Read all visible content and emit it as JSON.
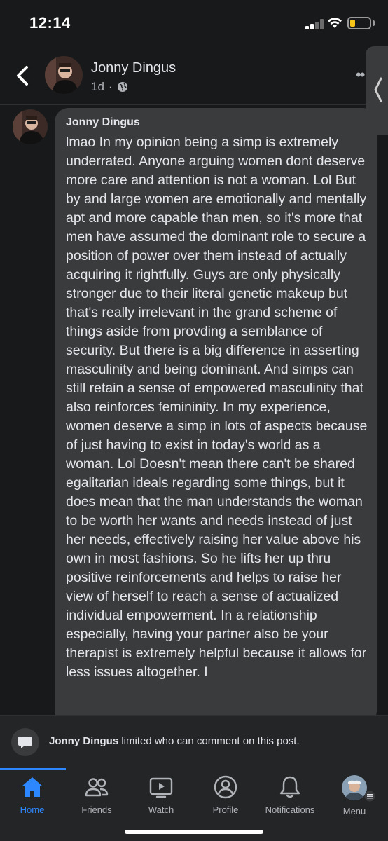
{
  "status": {
    "time": "12:14"
  },
  "post": {
    "author": "Jonny Dingus",
    "age": "1d",
    "privacy_icon": "globe-icon"
  },
  "comment": {
    "author": "Jonny Dingus",
    "text": "lmao In my opinion being a simp is extremely underrated. Anyone arguing women dont deserve more care and attention is not a woman. Lol But by and large women are emotionally and mentally apt and more capable than men, so it's more that men have assumed the dominant role to secure a position of power over them instead of actually acquiring it rightfully. Guys are only physically stronger due to their literal genetic makeup but that's really irrelevant in the grand scheme of things aside from provding a semblance of security. But there is a big difference in asserting masculinity and being dominant. And simps can still retain a sense of empowered masculinity that also reinforces femininity. In my experience, women deserve a simp in lots of aspects because of just having to exist in today's world as a woman. Lol Doesn't mean there can't be shared egalitarian ideals regarding some things, but it does mean that the man understands the woman to be worth her wants and needs instead of just her needs, effectively raising her value above his own in most fashions. So he lifts her up thru positive reinforcements and helps to raise her view of herself to reach a sense of actualized individual empowerment. In a relationship especially, having your partner also be your therapist is extremely helpful because it allows for less issues altogether. I"
  },
  "notice": {
    "name": "Jonny Dingus",
    "message": " limited who can comment on this post."
  },
  "tabs": [
    {
      "label": "Home",
      "icon": "home-icon",
      "active": true
    },
    {
      "label": "Friends",
      "icon": "friends-icon",
      "active": false
    },
    {
      "label": "Watch",
      "icon": "watch-icon",
      "active": false
    },
    {
      "label": "Profile",
      "icon": "profile-icon",
      "active": false
    },
    {
      "label": "Notifications",
      "icon": "bell-icon",
      "active": false
    },
    {
      "label": "Menu",
      "icon": "avatar-icon",
      "active": false
    }
  ],
  "colors": {
    "background": "#18191a",
    "bubble": "#3a3b3c",
    "accent": "#2d88ff",
    "battery": "#f5c518"
  }
}
